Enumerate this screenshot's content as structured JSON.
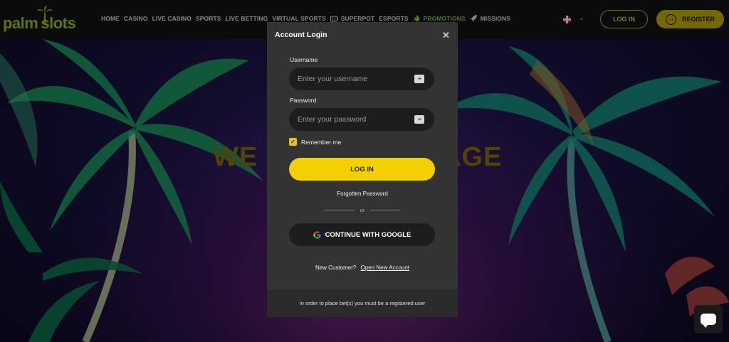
{
  "brand": {
    "logo_part1": "palm",
    "logo_part2": "slots"
  },
  "nav": {
    "items": [
      {
        "label": "HOME"
      },
      {
        "label": "CASINO"
      },
      {
        "label": "LIVE CASINO"
      },
      {
        "label": "SPORTS"
      },
      {
        "label": "LIVE BETTING"
      },
      {
        "label": "VIRTUAL SPORTS"
      },
      {
        "label": "SUPERPOT",
        "icon": "slot-icon"
      },
      {
        "label": "ESPORTS"
      },
      {
        "label": "PROMOTIONS",
        "icon": "gift-icon"
      },
      {
        "label": "MISSIONS",
        "icon": "rocket-icon"
      }
    ]
  },
  "header": {
    "language_icon": "uk-flag-icon",
    "login_label": "LOG IN",
    "register_label": "REGISTER"
  },
  "hero": {
    "title_left": "WE",
    "title_right": "AGE"
  },
  "modal": {
    "title": "Account Login",
    "close_icon": "close-icon",
    "username_label": "Username",
    "username_placeholder": "Enter your username",
    "username_value": "",
    "password_label": "Password",
    "password_placeholder": "Enter your password",
    "password_value": "",
    "remember_label": "Remember me",
    "remember_checked": true,
    "login_button": "LOG IN",
    "forgot_label": "Forgotten Password",
    "or_label": "or",
    "google_button": "CONTINUE WITH GOOGLE",
    "new_customer_text": "New Customer?",
    "open_account_link": "Open New Account",
    "footer_text": "In order to place bet(s) you must be a registered user"
  },
  "colors": {
    "accent_yellow": "#f4d000",
    "brand_green": "#a6c41a",
    "promo_green": "#8ec63f",
    "modal_bg": "#333333",
    "input_bg": "#1d1d1d"
  }
}
